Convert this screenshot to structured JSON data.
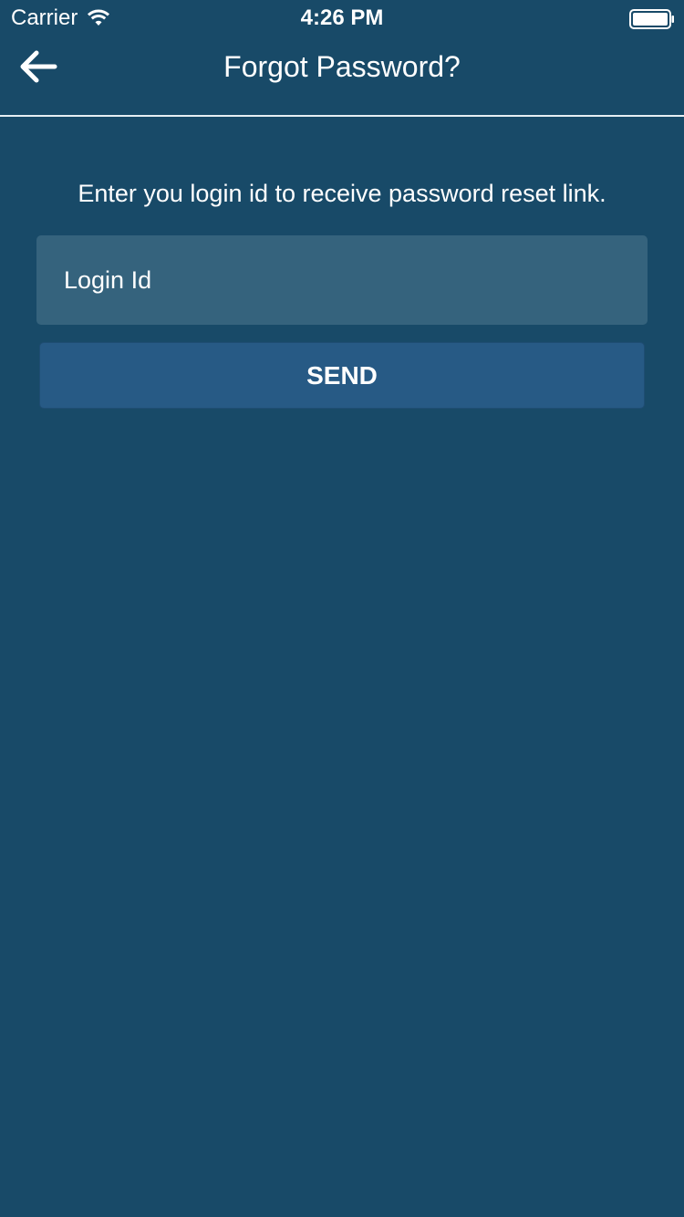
{
  "status_bar": {
    "carrier": "Carrier",
    "time": "4:26 PM",
    "wifi_icon": "wifi-icon",
    "battery_icon": "battery-icon"
  },
  "nav": {
    "back_icon": "arrow-left-icon",
    "title": "Forgot Password?"
  },
  "form": {
    "instruction": "Enter you login id to receive password reset link.",
    "login_placeholder": "Login Id",
    "login_value": "",
    "send_label": "SEND"
  },
  "colors": {
    "background": "#184a68",
    "input_bg": "#35637d",
    "button_bg": "#275a85",
    "text": "#ffffff"
  }
}
